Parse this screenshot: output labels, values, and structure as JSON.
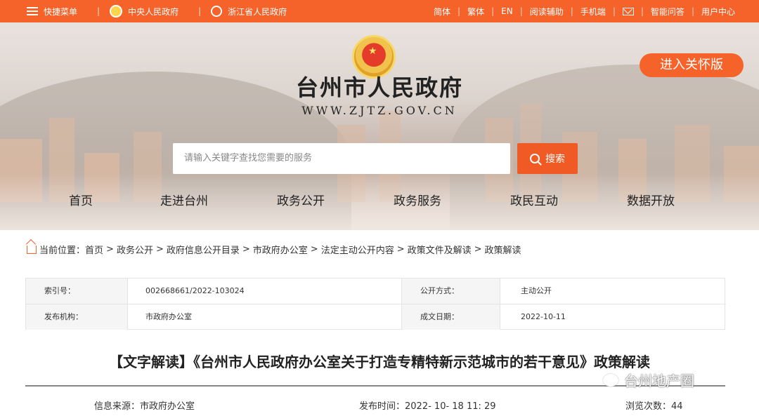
{
  "topbar": {
    "quick_menu": "快捷菜单",
    "central_gov": "中央人民政府",
    "zj_gov": "浙江省人民政府",
    "links": [
      "简体",
      "繁体",
      "EN",
      "阅读辅助",
      "手机端"
    ],
    "smart_qa": "智能问答",
    "user_center": "用户中心"
  },
  "header": {
    "title": "台州市人民政府",
    "url": "WWW.ZJTZ.GOV.CN",
    "care_button": "进入关怀版"
  },
  "search": {
    "placeholder": "请输入关键字查找您需要的服务",
    "button": "搜索"
  },
  "nav": [
    "首页",
    "走进台州",
    "政务公开",
    "政务服务",
    "政民互动",
    "数据开放"
  ],
  "breadcrumb": {
    "label": "当前位置：",
    "items": [
      "首页",
      "政务公开",
      "政府信息公开目录",
      "市政府办公室",
      "法定主动公开内容",
      "政策文件及解读",
      "政策解读"
    ]
  },
  "meta": {
    "index_key": "索引号：",
    "index_val": "002668661/2022-103024",
    "method_key": "公开方式：",
    "method_val": "主动公开",
    "publisher_key": "发布机构：",
    "publisher_val": "市政府办公室",
    "date_key": "成文日期：",
    "date_val": "2022-10-11"
  },
  "article": {
    "title": "【文字解读】《台州市人民政府办公室关于打造专精特新示范城市的若干意见》政策解读",
    "source_label": "信息来源：",
    "source": "市政府办公室",
    "time_label": "发布时间：",
    "time": "2022- 10- 18 11: 29",
    "views_label": "浏览次数：",
    "views": "44"
  },
  "watermark": "台州地产圈",
  "colors": {
    "accent": "#f5622a"
  }
}
